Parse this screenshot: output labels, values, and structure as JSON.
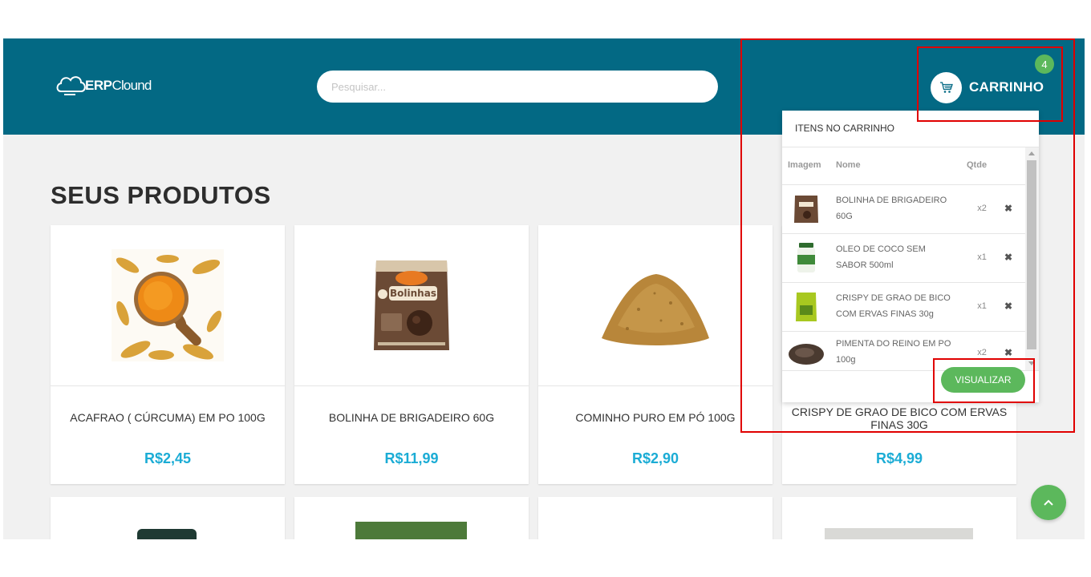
{
  "header": {
    "logo_strong": "ERP",
    "logo_light": "Clound",
    "search_placeholder": "Pesquisar...",
    "cart_label": "CARRINHO",
    "cart_count": "4",
    "header_color": "#036984"
  },
  "main": {
    "title": "SEUS PRODUTOS",
    "products": [
      {
        "name": "ACAFRAO ( CÚRCUMA) EM PO 100G",
        "price": "R$2,45"
      },
      {
        "name": "BOLINHA DE BRIGADEIRO 60G",
        "price": "R$11,99"
      },
      {
        "name": "COMINHO PURO EM PÓ 100G",
        "price": "R$2,90"
      },
      {
        "name": "CRISPY DE GRAO DE BICO COM ERVAS FINAS 30G",
        "price": "R$4,99"
      }
    ]
  },
  "cart_dropdown": {
    "title": "ITENS NO CARRINHO",
    "col_image": "Imagem",
    "col_name": "Nome",
    "col_qty": "Qtde",
    "items": [
      {
        "name": "BOLINHA DE BRIGADEIRO 60G",
        "qty": "x2",
        "remove": "✖"
      },
      {
        "name": "OLEO DE COCO SEM SABOR 500ml",
        "qty": "x1",
        "remove": "✖"
      },
      {
        "name": "CRISPY DE GRAO DE BICO COM ERVAS FINAS 30g",
        "qty": "x1",
        "remove": "✖"
      },
      {
        "name": "PIMENTA DO REINO EM PO 100g",
        "qty": "x2",
        "remove": "✖"
      }
    ],
    "view_button": "VISUALIZAR"
  },
  "colors": {
    "accent": "#5cb85c",
    "price": "#1bacd5"
  }
}
